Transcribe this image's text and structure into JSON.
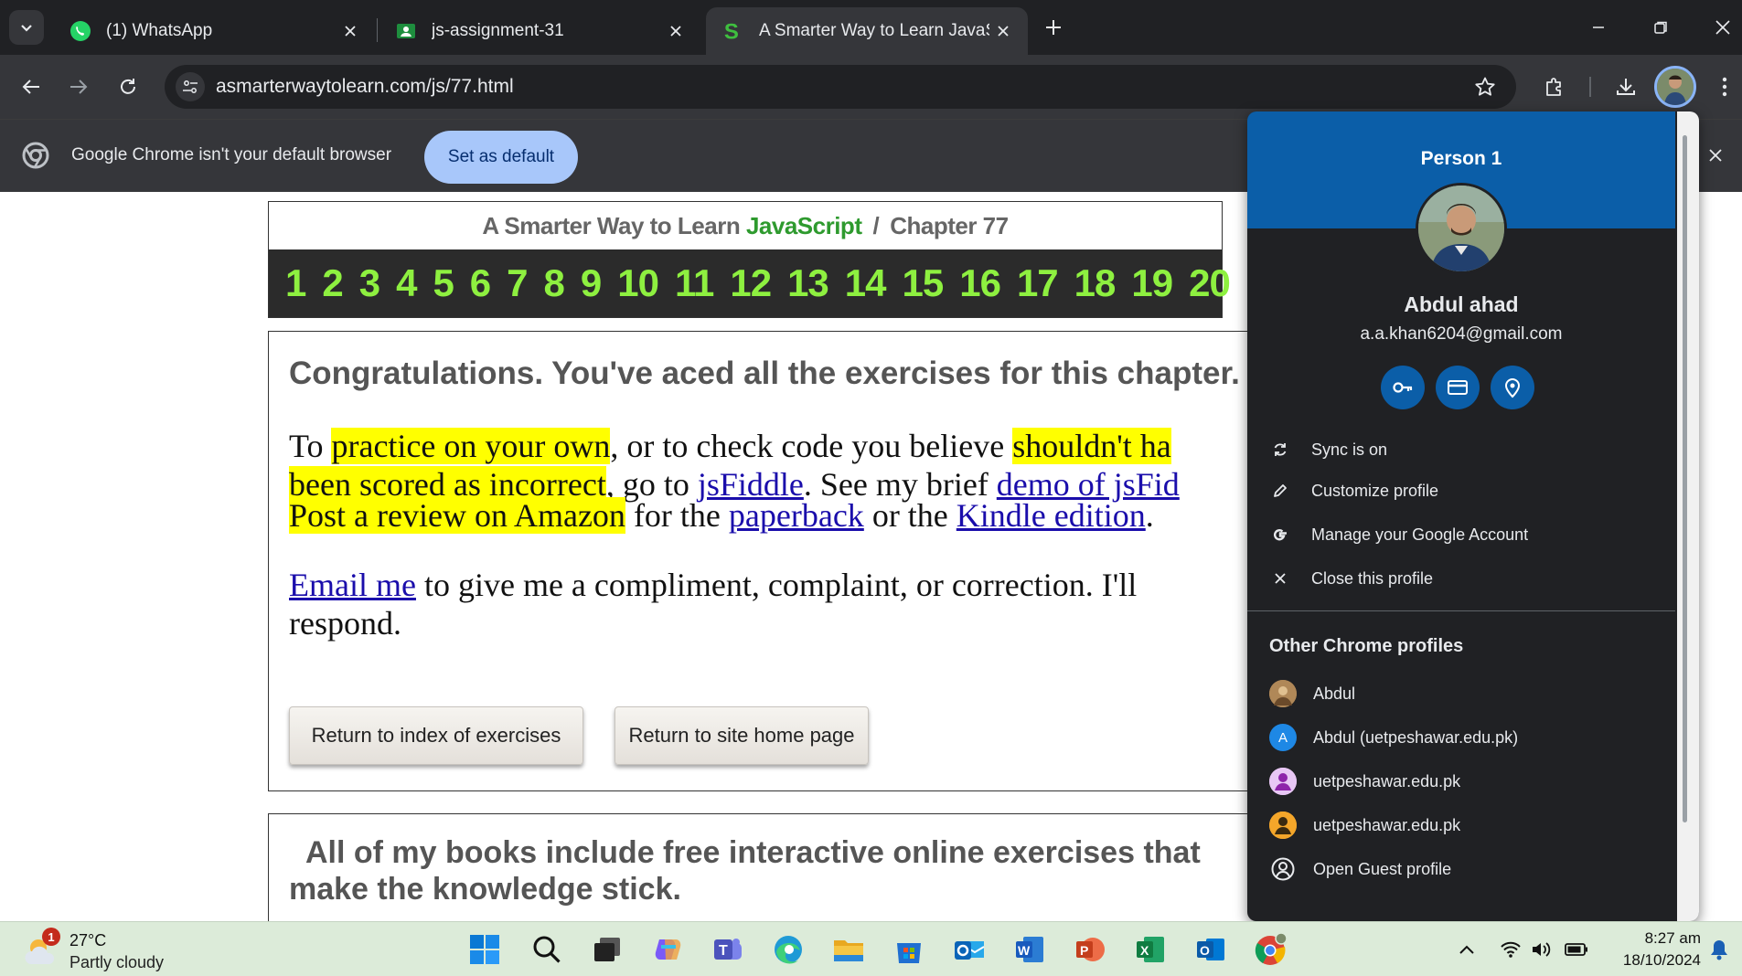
{
  "browser": {
    "tabs": [
      {
        "title": "(1) WhatsApp",
        "icon": "whatsapp-icon",
        "active": false
      },
      {
        "title": "js-assignment-31",
        "icon": "classroom-icon",
        "active": false
      },
      {
        "title": "A Smarter Way to Learn JavaScr",
        "icon": "smarter-way-icon",
        "active": true
      }
    ],
    "url": "asmarterwaytolearn.com/js/77.html"
  },
  "infobar": {
    "message": "Google Chrome isn't your default browser",
    "button": "Set as default"
  },
  "page": {
    "title_prefix": "A Smarter Way to Learn",
    "title_js": "JavaScript",
    "title_sep": "/",
    "title_chapter": "Chapter 77",
    "exercise_numbers": [
      "1",
      "2",
      "3",
      "4",
      "5",
      "6",
      "7",
      "8",
      "9",
      "10",
      "11",
      "12",
      "13",
      "14",
      "15",
      "16",
      "17",
      "18",
      "19",
      "20"
    ],
    "congrats": "Congratulations. You've aced all the exercises for this chapter.",
    "p1": {
      "a": "To ",
      "hl1": "practice on your own",
      "b": ", or to check code you believe ",
      "hl2": "shouldn't ha",
      "hl3": "been scored as incorrect",
      "c": ", go to ",
      "link1": "jsFiddle",
      "d": ". See my brief ",
      "link2": "demo of jsFid"
    },
    "p2": {
      "hl": "Post a review on Amazon",
      "a": " for the ",
      "link1": "paperback",
      "b": " or the ",
      "link2": "Kindle edition",
      "c": "."
    },
    "p3": {
      "link": "Email me",
      "a": " to give me a compliment, complaint, or correction. I'll",
      "b": "respond."
    },
    "btn_index": "Return to index of exercises",
    "btn_home": "Return to site home page",
    "books_line1": "All of my books include free interactive online exercises that",
    "books_line2": "make the knowledge stick."
  },
  "profile": {
    "header": "Person 1",
    "name": "Abdul ahad",
    "email": "a.a.khan6204@gmail.com",
    "menu": [
      "Sync is on",
      "Customize profile",
      "Manage your Google Account",
      "Close this profile"
    ],
    "other_title": "Other Chrome profiles",
    "others": [
      "Abdul",
      "Abdul (uetpeshawar.edu.pk)",
      "uetpeshawar.edu.pk",
      "uetpeshawar.edu.pk",
      "Open Guest profile"
    ],
    "other_initial": "A"
  },
  "taskbar": {
    "temp": "27°C",
    "condition": "Partly cloudy",
    "badge": "1",
    "time": "8:27 am",
    "date": "18/10/2024"
  },
  "colors": {
    "chrome_dark": "#202124",
    "chrome_toolbar": "#35363a",
    "profile_blue": "#0b5ea8",
    "js_green": "#2e9a2e",
    "number_green": "#8ef040",
    "highlight": "#ffff00",
    "link": "#1a0dab"
  }
}
